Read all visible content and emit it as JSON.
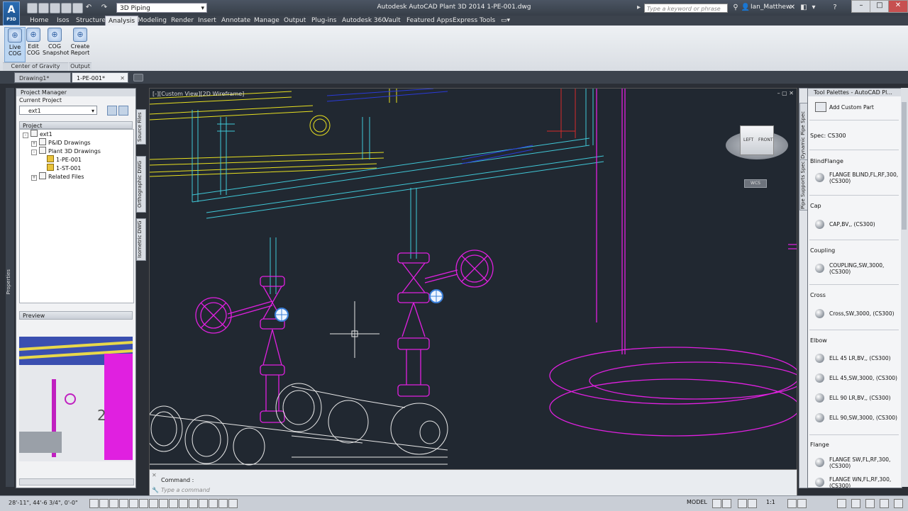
{
  "app": {
    "logo_letter": "A",
    "logo_sub": "P3D",
    "workspace": "3D Piping",
    "title": "Autodesk AutoCAD Plant 3D 2014    1-PE-001.dwg",
    "search_placeholder": "Type a keyword or phrase",
    "user": "Ian_Matthew"
  },
  "ribbon_tabs": [
    "Home",
    "Isos",
    "Structure",
    "Analysis",
    "Modeling",
    "Render",
    "Insert",
    "Annotate",
    "Manage",
    "Output",
    "Plug-ins",
    "Autodesk 360",
    "Vault",
    "Featured Apps",
    "Express Tools"
  ],
  "active_tab": "Analysis",
  "ribbon": {
    "live_cog": "Live COG",
    "edit_cog": "Edit COG",
    "cog_snapshot": "COG Snapshot",
    "create_report": "Create Report",
    "panel_cog": "Center of Gravity",
    "panel_output": "Output"
  },
  "doc_tabs": [
    "Drawing1*",
    "1-PE-001*"
  ],
  "project_manager": {
    "title": "Project Manager",
    "current_project_label": "Current Project",
    "current_project": "ext1",
    "project_header": "Project",
    "tree": [
      "ext1",
      "P&ID Drawings",
      "Plant 3D Drawings",
      "1-PE-001",
      "1-ST-001",
      "Related Files"
    ],
    "side_tabs": [
      "Source Files",
      "Orthographic DWG",
      "Isometric DWG"
    ],
    "preview_header": "Preview",
    "properties_label": "Properties"
  },
  "viewport": {
    "label": "[-][Custom View][2D Wireframe]",
    "viewcube_left": "LEFT",
    "viewcube_front": "FRONT",
    "wcs": "WCS"
  },
  "command": {
    "label": "Command :",
    "placeholder": "Type a command"
  },
  "status": {
    "coords": "28'-11\",   44'-6 3/4\",  0'-0\"",
    "model": "MODEL",
    "scale": "1:1"
  },
  "tool_palette": {
    "title": "Tool Palettes - AutoCAD Pl...",
    "side_tabs": [
      "Dynamic Pipe Spec",
      "Pipe Supports Spec"
    ],
    "add_custom": "Add Custom Part",
    "spec": "Spec: CS300",
    "categories": [
      {
        "name": "BlindFlange",
        "items": [
          "FLANGE BLIND,FL,RF,300, (CS300)"
        ]
      },
      {
        "name": "Cap",
        "items": [
          "CAP,BV,, (CS300)"
        ]
      },
      {
        "name": "Coupling",
        "items": [
          "COUPLING,SW,3000, (CS300)"
        ]
      },
      {
        "name": "Cross",
        "items": [
          "Cross,SW,3000, (CS300)"
        ]
      },
      {
        "name": "Elbow",
        "items": [
          "ELL 45 LR,BV,, (CS300)",
          "ELL 45,SW,3000, (CS300)",
          "ELL 90 LR,BV,, (CS300)",
          "ELL 90,SW,3000, (CS300)"
        ]
      },
      {
        "name": "Flange",
        "items": [
          "FLANGE SW,FL,RF,300, (CS300)",
          "FLANGE WN,FL,RF,300, (CS300)"
        ]
      }
    ]
  },
  "colors": {
    "accent": "#2a6db5",
    "pipe_magenta": "#e020e0",
    "pipe_cyan": "#40c8d8",
    "pipe_yellow": "#e8e020"
  }
}
